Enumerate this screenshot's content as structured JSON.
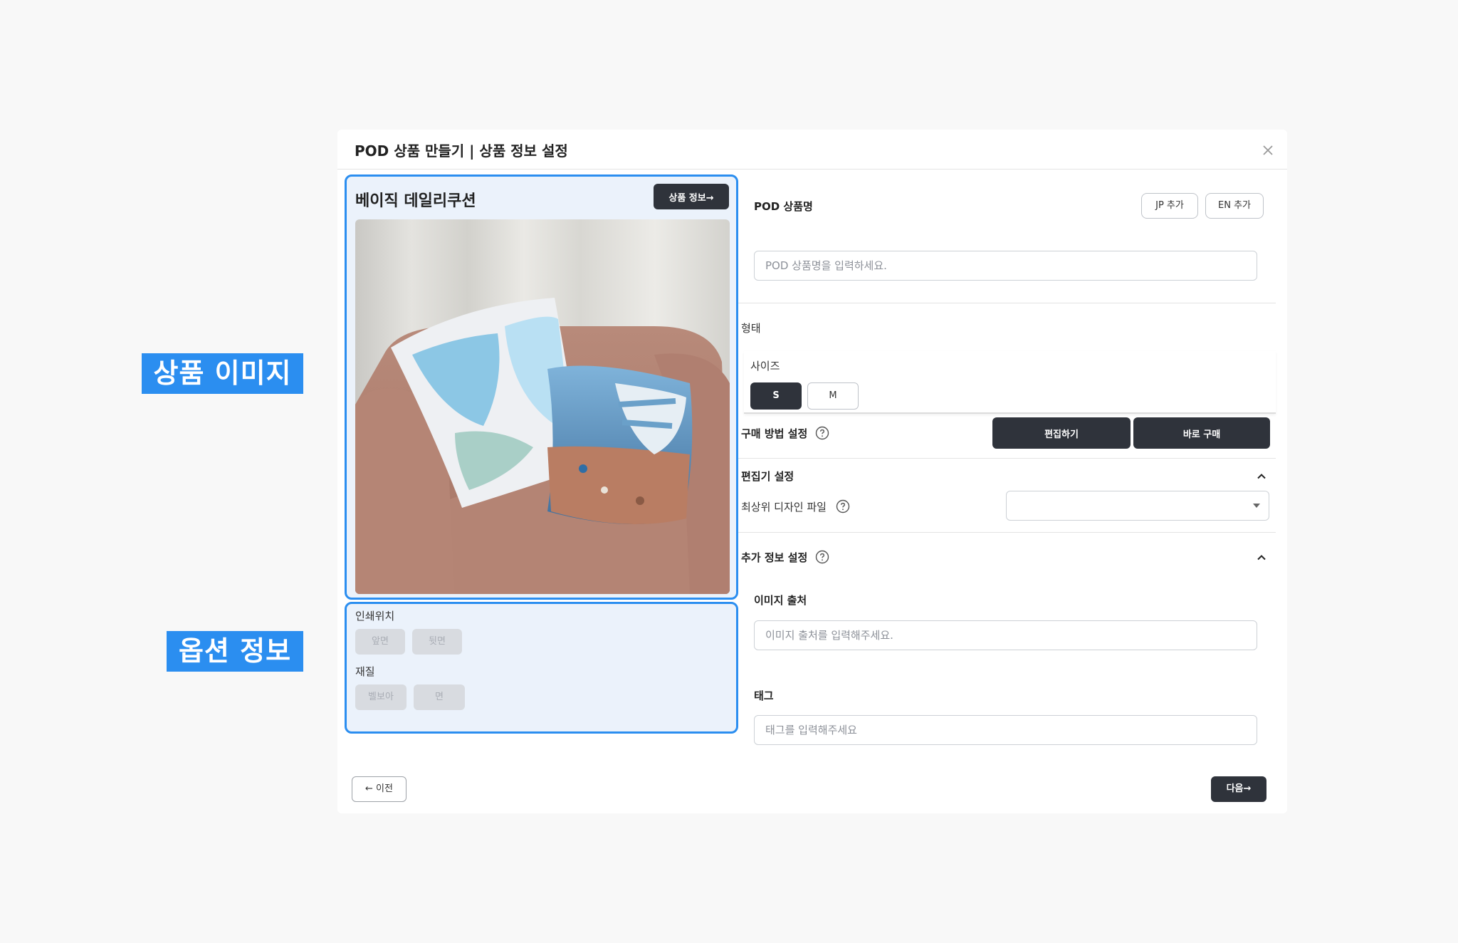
{
  "callouts": {
    "product_image": "상품 이미지",
    "option_info": "옵션 정보"
  },
  "modal": {
    "title": "POD 상품 만들기 | 상품 정보 설정",
    "close_icon": "close-icon"
  },
  "product": {
    "name": "베이직 데일리쿠션",
    "info_button": "상품 정보→",
    "image_alt": "cushions-on-armchair-photo"
  },
  "options": {
    "print_position_label": "인쇄위치",
    "print_positions": [
      "앞면",
      "뒷면"
    ],
    "material_label": "재질",
    "materials": [
      "벨보아",
      "면"
    ]
  },
  "form": {
    "pod_name_label": "POD 상품명",
    "jp_add": "JP 추가",
    "en_add": "EN 추가",
    "pod_name_placeholder": "POD 상품명을 입력하세요.",
    "shape_label": "형태",
    "size_label": "사이즈",
    "sizes": [
      {
        "label": "S",
        "selected": true
      },
      {
        "label": "M",
        "selected": false
      }
    ],
    "purchase_method_label": "구매 방법 설정",
    "edit_button": "편집하기",
    "buy_now_button": "바로 구매",
    "editor_settings_label": "편집기 설정",
    "top_design_file_label": "최상위 디자인 파일",
    "top_design_file_value": "",
    "extra_info_label": "추가 정보 설정",
    "image_source_label": "이미지 출처",
    "image_source_placeholder": "이미지 출처를 입력해주세요.",
    "tag_label": "태그",
    "tag_placeholder": "태그를 입력해주세요"
  },
  "footer": {
    "prev_button": "← 이전",
    "next_button": "다음→"
  },
  "colors": {
    "accent_blue": "#2b8ef0",
    "panel_bg": "#ebf2fb",
    "dark_button": "#2f333b"
  }
}
